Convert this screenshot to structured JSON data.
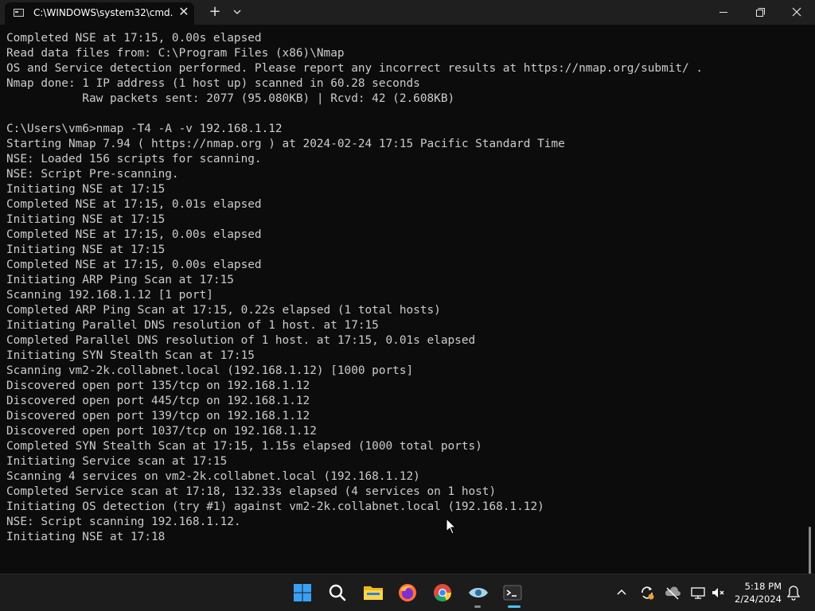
{
  "window": {
    "tab_title": "C:\\WINDOWS\\system32\\cmd.",
    "tab_close": "✕",
    "new_tab": "+"
  },
  "terminal": {
    "lines": [
      "Completed NSE at 17:15, 0.00s elapsed",
      "Read data files from: C:\\Program Files (x86)\\Nmap",
      "OS and Service detection performed. Please report any incorrect results at https://nmap.org/submit/ .",
      "Nmap done: 1 IP address (1 host up) scanned in 60.28 seconds",
      "           Raw packets sent: 2077 (95.080KB) | Rcvd: 42 (2.608KB)",
      "",
      "C:\\Users\\vm6>nmap -T4 -A -v 192.168.1.12",
      "Starting Nmap 7.94 ( https://nmap.org ) at 2024-02-24 17:15 Pacific Standard Time",
      "NSE: Loaded 156 scripts for scanning.",
      "NSE: Script Pre-scanning.",
      "Initiating NSE at 17:15",
      "Completed NSE at 17:15, 0.01s elapsed",
      "Initiating NSE at 17:15",
      "Completed NSE at 17:15, 0.00s elapsed",
      "Initiating NSE at 17:15",
      "Completed NSE at 17:15, 0.00s elapsed",
      "Initiating ARP Ping Scan at 17:15",
      "Scanning 192.168.1.12 [1 port]",
      "Completed ARP Ping Scan at 17:15, 0.22s elapsed (1 total hosts)",
      "Initiating Parallel DNS resolution of 1 host. at 17:15",
      "Completed Parallel DNS resolution of 1 host. at 17:15, 0.01s elapsed",
      "Initiating SYN Stealth Scan at 17:15",
      "Scanning vm2-2k.collabnet.local (192.168.1.12) [1000 ports]",
      "Discovered open port 135/tcp on 192.168.1.12",
      "Discovered open port 445/tcp on 192.168.1.12",
      "Discovered open port 139/tcp on 192.168.1.12",
      "Discovered open port 1037/tcp on 192.168.1.12",
      "Completed SYN Stealth Scan at 17:15, 1.15s elapsed (1000 total ports)",
      "Initiating Service scan at 17:15",
      "Scanning 4 services on vm2-2k.collabnet.local (192.168.1.12)",
      "Completed Service scan at 17:18, 132.33s elapsed (4 services on 1 host)",
      "Initiating OS detection (try #1) against vm2-2k.collabnet.local (192.168.1.12)",
      "NSE: Script scanning 192.168.1.12.",
      "Initiating NSE at 17:18"
    ]
  },
  "taskbar": {
    "apps": [
      {
        "name": "start-icon"
      },
      {
        "name": "search-icon"
      },
      {
        "name": "file-explorer-icon"
      },
      {
        "name": "firefox-icon"
      },
      {
        "name": "chrome-icon"
      },
      {
        "name": "network-eye-icon"
      },
      {
        "name": "terminal-icon"
      }
    ],
    "time": "5:18 PM",
    "date": "2/24/2024",
    "accent_color": "#4cc2ff"
  }
}
